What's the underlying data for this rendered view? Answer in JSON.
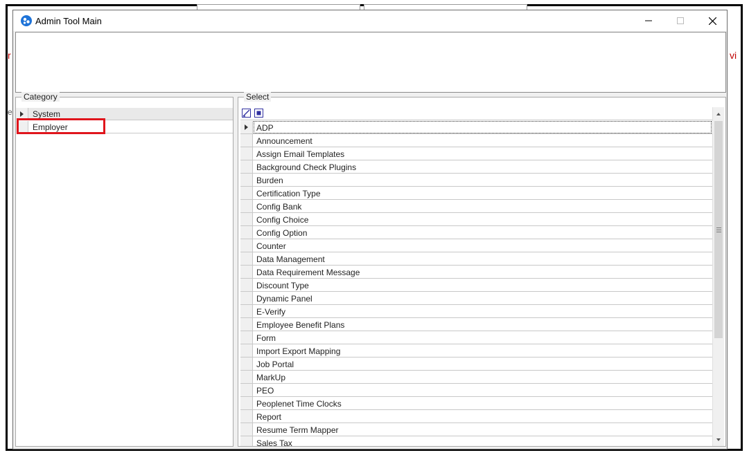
{
  "window": {
    "title": "Admin Tool Main"
  },
  "background": {
    "left_text": "r",
    "left_text2": "ec",
    "right_text": "vi"
  },
  "category": {
    "legend": "Category",
    "rows": [
      {
        "label": "System",
        "current": true
      },
      {
        "label": "Employer",
        "highlighted": true
      }
    ]
  },
  "select": {
    "legend": "Select",
    "items": [
      "ADP",
      "Announcement",
      "Assign Email Templates",
      "Background Check Plugins",
      "Burden",
      "Certification Type",
      "Config Bank",
      "Config Choice",
      "Config Option",
      "Counter",
      "Data Management",
      "Data Requirement Message",
      "Discount Type",
      "Dynamic Panel",
      "E-Verify",
      "Employee Benefit Plans",
      "Form",
      "Import Export Mapping",
      "Job Portal",
      "MarkUp",
      "PEO",
      "Peoplenet Time Clocks",
      "Report",
      "Resume Term Mapper",
      "Sales Tax"
    ]
  },
  "colors": {
    "highlight": "#e0151c",
    "icon_blue": "#1e73d8"
  }
}
